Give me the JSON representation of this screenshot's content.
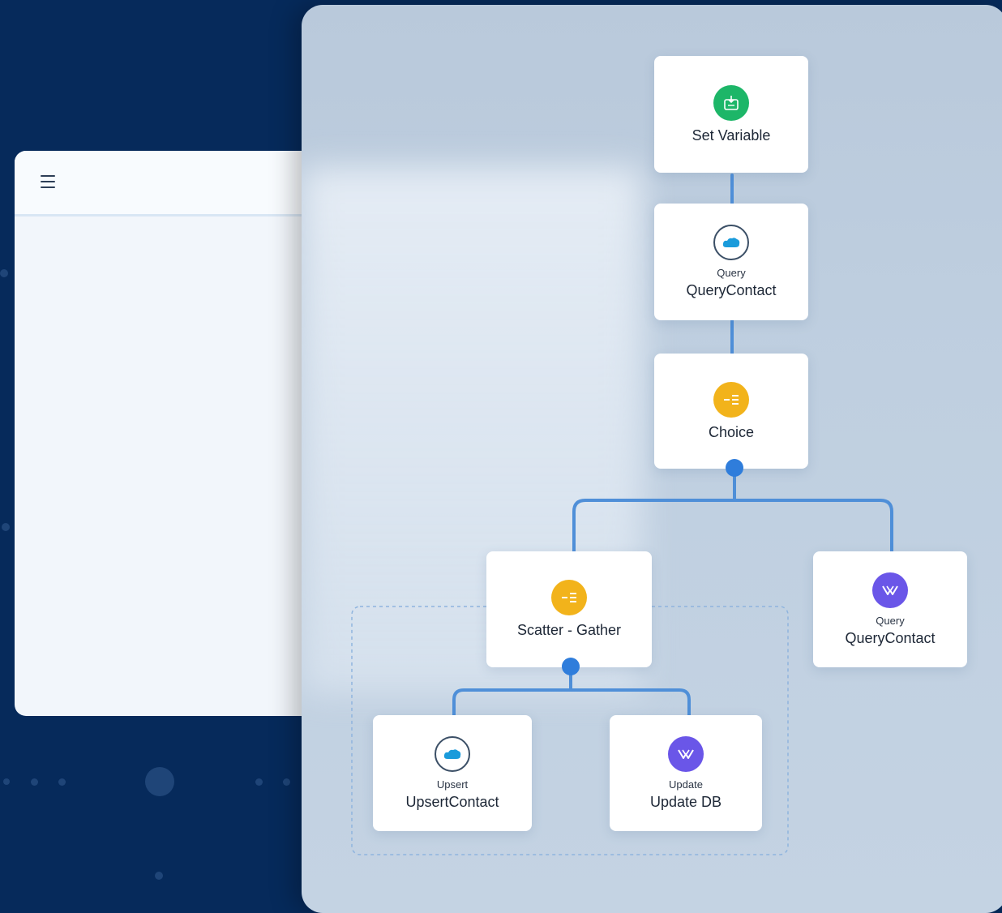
{
  "colors": {
    "background": "#062a5b",
    "connector": "#4f8fd8",
    "handle": "#2f7ddb",
    "set_variable_icon": "#1db668",
    "choice_icon": "#f2b31b",
    "scatter_icon": "#f2b31b",
    "database_icon": "#6a56e8"
  },
  "sidebar": {
    "menu_icon": "hamburger-menu-icon"
  },
  "flow": {
    "set_variable": {
      "icon": "set-variable-icon",
      "label": "Set Variable"
    },
    "query_contact": {
      "icon": "salesforce-cloud-icon",
      "type": "Query",
      "label": "QueryContact"
    },
    "choice": {
      "icon": "choice-router-icon",
      "label": "Choice"
    },
    "scatter_gather": {
      "icon": "scatter-gather-icon",
      "label": "Scatter - Gather"
    },
    "query_contact_db": {
      "icon": "database-connector-icon",
      "type": "Query",
      "label": "QueryContact"
    },
    "upsert_contact": {
      "icon": "salesforce-cloud-icon",
      "type": "Upsert",
      "label": "UpsertContact"
    },
    "update_db": {
      "icon": "database-connector-icon",
      "type": "Update",
      "label": "Update DB"
    }
  }
}
